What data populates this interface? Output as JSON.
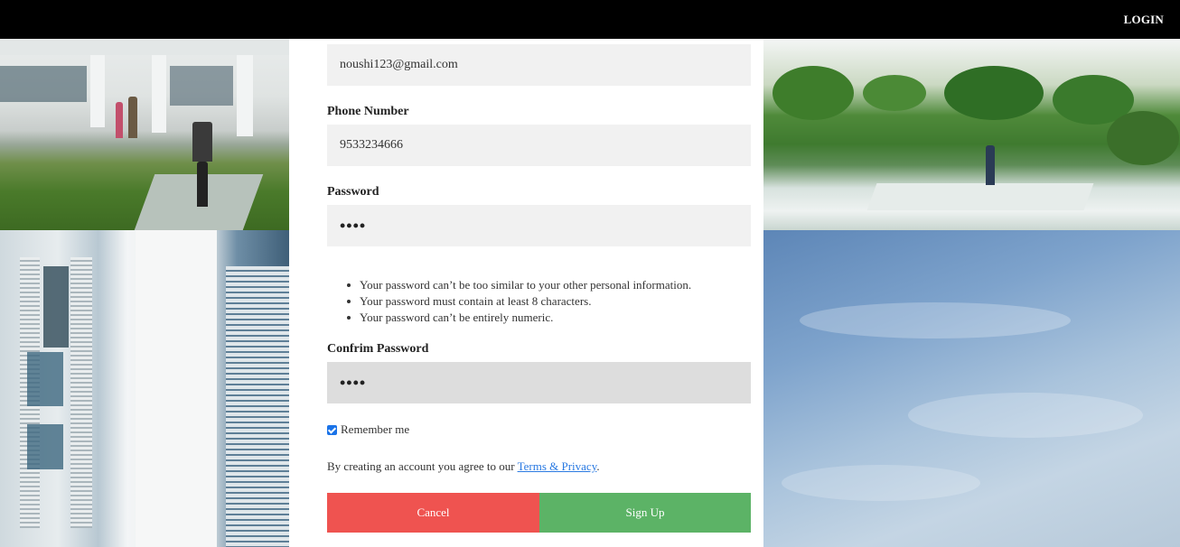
{
  "nav": {
    "login_label": "LOGIN"
  },
  "form": {
    "email_value": "noushi123@gmail.com",
    "phone_label": "Phone Number",
    "phone_value": "9533234666",
    "password_label": "Password",
    "password_value": "••••",
    "password_rules": [
      "Your password can’t be too similar to your other personal information.",
      "Your password must contain at least 8 characters.",
      "Your password can’t be entirely numeric."
    ],
    "confirm_label": "Confrim Password",
    "confirm_value": "••••",
    "remember_label": "Remember me",
    "remember_checked": true,
    "terms_prefix": "By creating an account you agree to our ",
    "terms_link": "Terms & Privacy",
    "terms_suffix": ".",
    "cancel_label": "Cancel",
    "signup_label": "Sign Up"
  },
  "colors": {
    "cancel": "#ef5350",
    "signup": "#5cb366",
    "link": "#2a7ae2",
    "checkbox": "#1a73e8"
  }
}
